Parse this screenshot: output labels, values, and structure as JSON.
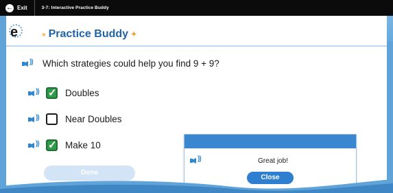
{
  "topbar": {
    "exit_label": "Exit",
    "activity_title": "3-7: Interactive Practice Buddy"
  },
  "header": {
    "logo_text": "e",
    "brand_title": "Practice Buddy",
    "brand_star": "»",
    "brand_star_after": "✦"
  },
  "question": {
    "text": "Which strategies could help you find 9 + 9?"
  },
  "options": [
    {
      "label": "Doubles",
      "checked": true
    },
    {
      "label": "Near Doubles",
      "checked": false
    },
    {
      "label": "Make 10",
      "checked": true
    }
  ],
  "done_button": {
    "label": "Done"
  },
  "feedback_popup": {
    "message": "Great job!",
    "close_label": "Close"
  },
  "colors": {
    "accent_blue": "#2f86d1",
    "check_green": "#2e9a4a",
    "brand_text": "#1f63a6"
  }
}
